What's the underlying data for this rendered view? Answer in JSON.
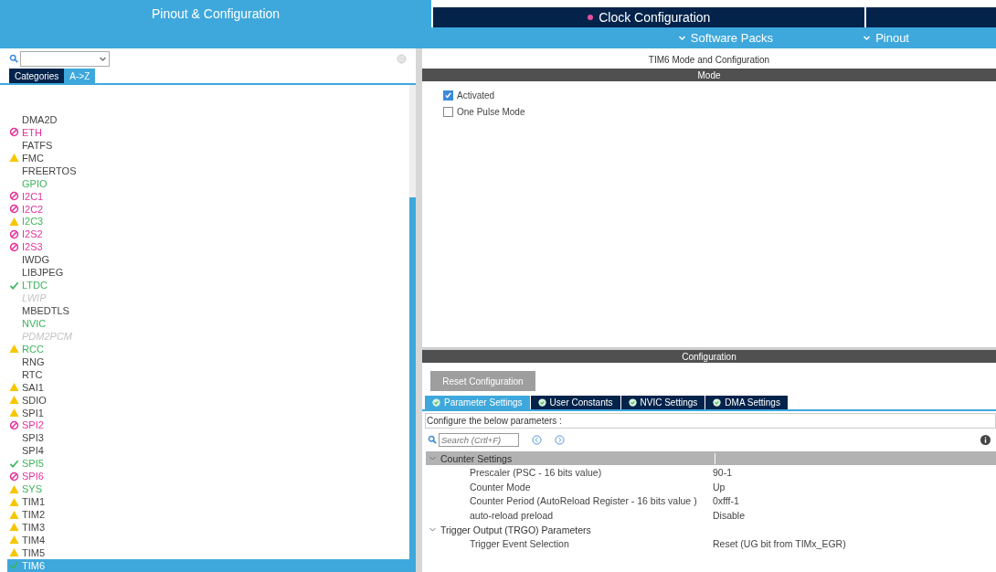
{
  "top_tabs": [
    {
      "label": "Pinout & Configuration",
      "selected": true,
      "dot": false
    },
    {
      "label": "Clock Configuration",
      "selected": false,
      "dot": true
    }
  ],
  "sub_menu": [
    "Software Packs",
    "Pinout"
  ],
  "sidebar": {
    "view_tabs": [
      {
        "label": "Categories",
        "selected": false
      },
      {
        "label": "A->Z",
        "selected": true
      }
    ],
    "items": [
      {
        "label": "DMA2D",
        "kind": "none",
        "color": "#444444",
        "disabled": false,
        "selected": false
      },
      {
        "label": "ETH",
        "kind": "error",
        "color": "#e4329a",
        "disabled": false,
        "selected": false
      },
      {
        "label": "FATFS",
        "kind": "none",
        "color": "#444444",
        "disabled": false,
        "selected": false
      },
      {
        "label": "FMC",
        "kind": "warning",
        "color": "#444444",
        "disabled": false,
        "selected": false
      },
      {
        "label": "FREERTOS",
        "kind": "none",
        "color": "#444444",
        "disabled": false,
        "selected": false
      },
      {
        "label": "GPIO",
        "kind": "none",
        "color": "#3cb55b",
        "disabled": false,
        "selected": false
      },
      {
        "label": "I2C1",
        "kind": "error",
        "color": "#e4329a",
        "disabled": false,
        "selected": false
      },
      {
        "label": "I2C2",
        "kind": "error",
        "color": "#e4329a",
        "disabled": false,
        "selected": false
      },
      {
        "label": "I2C3",
        "kind": "warning",
        "color": "#3cb55b",
        "disabled": false,
        "selected": false
      },
      {
        "label": "I2S2",
        "kind": "error",
        "color": "#e4329a",
        "disabled": false,
        "selected": false
      },
      {
        "label": "I2S3",
        "kind": "error",
        "color": "#e4329a",
        "disabled": false,
        "selected": false
      },
      {
        "label": "IWDG",
        "kind": "none",
        "color": "#444444",
        "disabled": false,
        "selected": false
      },
      {
        "label": "LIBJPEG",
        "kind": "none",
        "color": "#444444",
        "disabled": false,
        "selected": false
      },
      {
        "label": "LTDC",
        "kind": "ok",
        "color": "#3cb55b",
        "disabled": false,
        "selected": false
      },
      {
        "label": "LWIP",
        "kind": "none",
        "color": "#c4c4c4",
        "disabled": true,
        "selected": false
      },
      {
        "label": "MBEDTLS",
        "kind": "none",
        "color": "#444444",
        "disabled": false,
        "selected": false
      },
      {
        "label": "NVIC",
        "kind": "none",
        "color": "#3cb55b",
        "disabled": false,
        "selected": false
      },
      {
        "label": "PDM2PCM",
        "kind": "none",
        "color": "#c4c4c4",
        "disabled": true,
        "selected": false
      },
      {
        "label": "RCC",
        "kind": "warning",
        "color": "#3cb55b",
        "disabled": false,
        "selected": false
      },
      {
        "label": "RNG",
        "kind": "none",
        "color": "#444444",
        "disabled": false,
        "selected": false
      },
      {
        "label": "RTC",
        "kind": "none",
        "color": "#444444",
        "disabled": false,
        "selected": false
      },
      {
        "label": "SAI1",
        "kind": "warning",
        "color": "#444444",
        "disabled": false,
        "selected": false
      },
      {
        "label": "SDIO",
        "kind": "warning",
        "color": "#444444",
        "disabled": false,
        "selected": false
      },
      {
        "label": "SPI1",
        "kind": "warning",
        "color": "#444444",
        "disabled": false,
        "selected": false
      },
      {
        "label": "SPI2",
        "kind": "error",
        "color": "#e4329a",
        "disabled": false,
        "selected": false
      },
      {
        "label": "SPI3",
        "kind": "none",
        "color": "#444444",
        "disabled": false,
        "selected": false
      },
      {
        "label": "SPI4",
        "kind": "none",
        "color": "#444444",
        "disabled": false,
        "selected": false
      },
      {
        "label": "SPI5",
        "kind": "ok",
        "color": "#3cb55b",
        "disabled": false,
        "selected": false
      },
      {
        "label": "SPI6",
        "kind": "error",
        "color": "#e4329a",
        "disabled": false,
        "selected": false
      },
      {
        "label": "SYS",
        "kind": "warning",
        "color": "#3cb55b",
        "disabled": false,
        "selected": false
      },
      {
        "label": "TIM1",
        "kind": "warning",
        "color": "#444444",
        "disabled": false,
        "selected": false
      },
      {
        "label": "TIM2",
        "kind": "warning",
        "color": "#444444",
        "disabled": false,
        "selected": false
      },
      {
        "label": "TIM3",
        "kind": "warning",
        "color": "#444444",
        "disabled": false,
        "selected": false
      },
      {
        "label": "TIM4",
        "kind": "warning",
        "color": "#444444",
        "disabled": false,
        "selected": false
      },
      {
        "label": "TIM5",
        "kind": "warning",
        "color": "#444444",
        "disabled": false,
        "selected": false
      },
      {
        "label": "TIM6",
        "kind": "ok",
        "color": "#ffffff",
        "disabled": false,
        "selected": true
      }
    ]
  },
  "main": {
    "title": "TIM6 Mode and Configuration",
    "mode": {
      "header": "Mode",
      "options": [
        {
          "label": "Activated",
          "checked": true
        },
        {
          "label": "One Pulse Mode",
          "checked": false
        }
      ]
    },
    "configuration": {
      "header": "Configuration",
      "reset_button": "Reset Configuration",
      "tabs": [
        {
          "label": "Parameter Settings",
          "selected": true
        },
        {
          "label": "User Constants",
          "selected": false
        },
        {
          "label": "NVIC Settings",
          "selected": false
        },
        {
          "label": "DMA Settings",
          "selected": false
        }
      ],
      "hint": "Configure the below parameters :",
      "search": {
        "placeholder": "Search (Crtl+F)"
      },
      "groups": [
        {
          "label": "Counter Settings",
          "expanded": true,
          "selected": true,
          "params": [
            {
              "name": "Prescaler (PSC - 16 bits value)",
              "value": "90-1"
            },
            {
              "name": "Counter Mode",
              "value": "Up"
            },
            {
              "name": "Counter Period (AutoReload Register - 16 bits value )",
              "value": "0xfff-1"
            },
            {
              "name": "auto-reload preload",
              "value": "Disable"
            }
          ]
        },
        {
          "label": "Trigger Output (TRGO) Parameters",
          "expanded": true,
          "selected": false,
          "params": [
            {
              "name": "Trigger Event Selection",
              "value": "Reset (UG bit from TIMx_EGR)"
            }
          ]
        }
      ]
    }
  }
}
